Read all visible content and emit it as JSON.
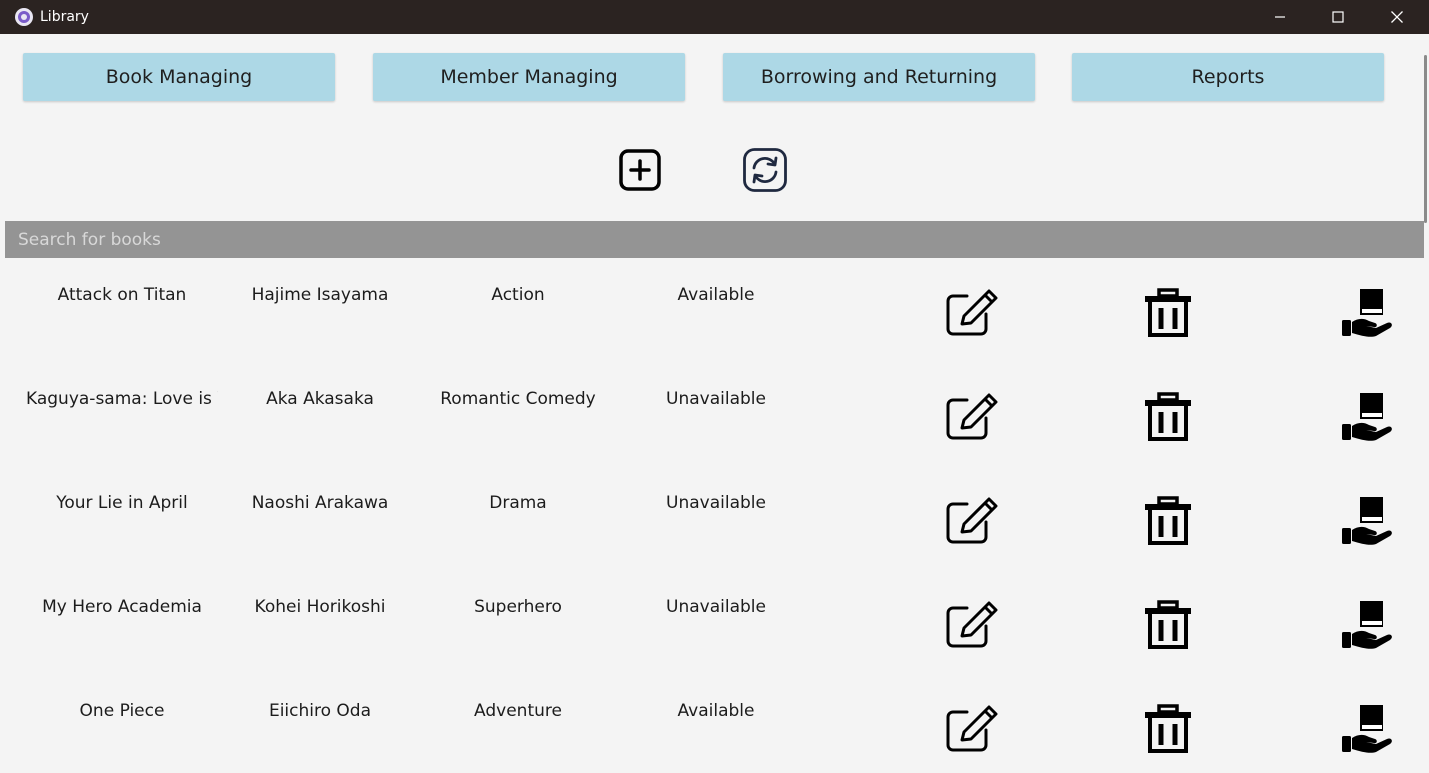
{
  "window": {
    "title": "Library"
  },
  "nav": {
    "book_managing": "Book Managing",
    "member_managing": "Member Managing",
    "borrowing_returning": "Borrowing and Returning",
    "reports": "Reports"
  },
  "search": {
    "placeholder": "Search for books",
    "value": ""
  },
  "books": [
    {
      "title": "Attack on Titan",
      "author": "Hajime Isayama",
      "genre": "Action",
      "status": "Available"
    },
    {
      "title": "Kaguya-sama: Love is W",
      "author": "Aka Akasaka",
      "genre": "Romantic Comedy",
      "status": "Unavailable"
    },
    {
      "title": "Your Lie in April",
      "author": "Naoshi Arakawa",
      "genre": "Drama",
      "status": "Unavailable"
    },
    {
      "title": "My Hero Academia",
      "author": "Kohei Horikoshi",
      "genre": "Superhero",
      "status": "Unavailable"
    },
    {
      "title": "One Piece",
      "author": "Eiichiro Oda",
      "genre": "Adventure",
      "status": "Available"
    }
  ],
  "icons": {
    "app": "app-logo-icon",
    "add": "plus-square-icon",
    "refresh": "refresh-icon",
    "edit": "edit-icon",
    "delete": "trash-icon",
    "lend": "hand-book-icon"
  },
  "colors": {
    "titlebar": "#2b2321",
    "background": "#f4f4f4",
    "nav_button": "#add8e6",
    "search_bar": "#949494",
    "refresh_icon": "#1f2940"
  }
}
